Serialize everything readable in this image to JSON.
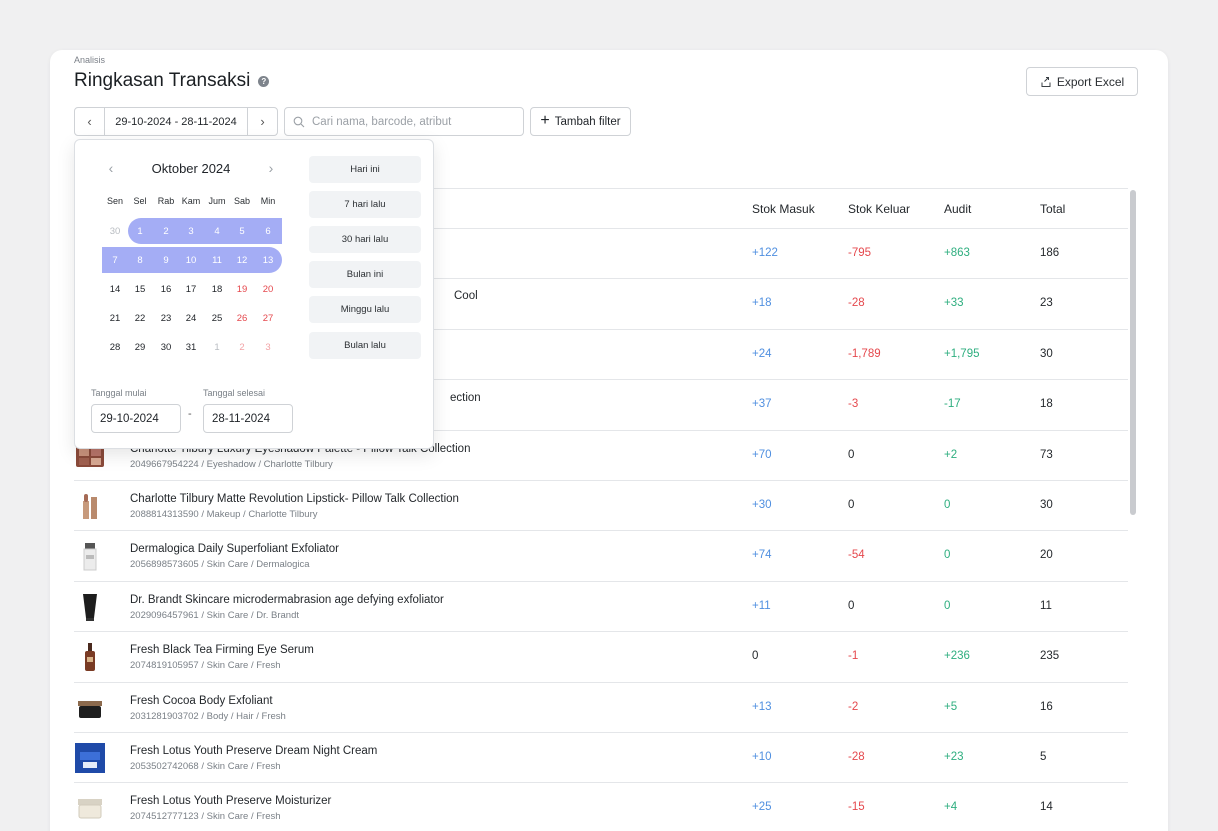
{
  "header": {
    "eyebrow": "Analisis",
    "title": "Ringkasan Transaksi",
    "help": "?",
    "export_label": "Export Excel"
  },
  "toolbar": {
    "prev": "‹",
    "next": "›",
    "date_range": "29-10-2024 - 28-11-2024",
    "search_placeholder": "Cari nama, barcode, atribut",
    "add_filter_label": "Tambah filter"
  },
  "table": {
    "columns": [
      "Stok Masuk",
      "Stok Keluar",
      "Audit",
      "Total"
    ],
    "rows": [
      {
        "name": "",
        "sub": "",
        "in": "+122",
        "out": "-795",
        "audit": "+863",
        "total": "186",
        "in_tone": "blue",
        "out_tone": "red",
        "audit_tone": "green",
        "thumb": "none"
      },
      {
        "name": "Cool",
        "sub": "",
        "in": "+18",
        "out": "-28",
        "audit": "+33",
        "total": "23",
        "in_tone": "blue",
        "out_tone": "red",
        "audit_tone": "green",
        "thumb": "none"
      },
      {
        "name": "",
        "sub": "",
        "in": "+24",
        "out": "-1,789",
        "audit": "+1,795",
        "total": "30",
        "in_tone": "blue",
        "out_tone": "red",
        "audit_tone": "green",
        "thumb": "none"
      },
      {
        "name": "ection",
        "sub": "",
        "in": "+37",
        "out": "-3",
        "audit": "-17",
        "total": "18",
        "in_tone": "blue",
        "out_tone": "red",
        "audit_tone": "green",
        "thumb": "none"
      },
      {
        "name": "Charlotte Tilbury Luxury Eyeshadow Palette - Pillow Talk Collection",
        "sub": "2049667954224 / Eyeshadow / Charlotte Tilbury",
        "in": "+70",
        "out": "0",
        "audit": "+2",
        "total": "73",
        "in_tone": "blue",
        "out_tone": "neutral",
        "audit_tone": "green",
        "thumb": "palette"
      },
      {
        "name": "Charlotte Tilbury Matte Revolution Lipstick- Pillow Talk Collection",
        "sub": "2088814313590 / Makeup / Charlotte Tilbury",
        "in": "+30",
        "out": "0",
        "audit": "0",
        "total": "30",
        "in_tone": "blue",
        "out_tone": "neutral",
        "audit_tone": "green",
        "thumb": "lipstick"
      },
      {
        "name": "Dermalogica Daily Superfoliant Exfoliator",
        "sub": "2056898573605 / Skin Care / Dermalogica",
        "in": "+74",
        "out": "-54",
        "audit": "0",
        "total": "20",
        "in_tone": "blue",
        "out_tone": "red",
        "audit_tone": "green",
        "thumb": "bottle-white"
      },
      {
        "name": "Dr. Brandt Skincare microdermabrasion age defying exfoliator",
        "sub": "2029096457961 / Skin Care / Dr. Brandt",
        "in": "+11",
        "out": "0",
        "audit": "0",
        "total": "11",
        "in_tone": "blue",
        "out_tone": "neutral",
        "audit_tone": "green",
        "thumb": "tube-black"
      },
      {
        "name": "Fresh Black Tea Firming Eye Serum",
        "sub": "2074819105957 / Skin Care / Fresh",
        "in": "0",
        "out": "-1",
        "audit": "+236",
        "total": "235",
        "in_tone": "neutral",
        "out_tone": "red",
        "audit_tone": "green",
        "thumb": "serum"
      },
      {
        "name": "Fresh Cocoa Body Exfoliant",
        "sub": "2031281903702 / Body / Hair / Fresh",
        "in": "+13",
        "out": "-2",
        "audit": "+5",
        "total": "16",
        "in_tone": "blue",
        "out_tone": "red",
        "audit_tone": "green",
        "thumb": "jar-dark"
      },
      {
        "name": "Fresh Lotus Youth Preserve Dream Night Cream",
        "sub": "2053502742068 / Skin Care / Fresh",
        "in": "+10",
        "out": "-28",
        "audit": "+23",
        "total": "5",
        "in_tone": "blue",
        "out_tone": "red",
        "audit_tone": "green",
        "thumb": "box-blue"
      },
      {
        "name": "Fresh Lotus Youth Preserve Moisturizer",
        "sub": "2074512777123 / Skin Care / Fresh",
        "in": "+25",
        "out": "-15",
        "audit": "+4",
        "total": "14",
        "in_tone": "blue",
        "out_tone": "red",
        "audit_tone": "green",
        "thumb": "jar-light"
      }
    ]
  },
  "datepicker": {
    "month_label": "Oktober 2024",
    "weekdays": [
      "Sen",
      "Sel",
      "Rab",
      "Kam",
      "Jum",
      "Sab",
      "Min"
    ],
    "weeks": [
      [
        "30",
        "1",
        "2",
        "3",
        "4",
        "5",
        "6"
      ],
      [
        "7",
        "8",
        "9",
        "10",
        "11",
        "12",
        "13"
      ],
      [
        "14",
        "15",
        "16",
        "17",
        "18",
        "19",
        "20"
      ],
      [
        "21",
        "22",
        "23",
        "24",
        "25",
        "26",
        "27"
      ],
      [
        "28",
        "29",
        "30",
        "31",
        "1",
        "2",
        "3"
      ]
    ],
    "presets": [
      "Hari ini",
      "7 hari lalu",
      "30 hari lalu",
      "Bulan ini",
      "Minggu lalu",
      "Bulan lalu"
    ],
    "start_label": "Tanggal mulai",
    "end_label": "Tanggal selesai",
    "start_value": "29-10-2024",
    "end_value": "28-11-2024",
    "separator": "-"
  },
  "colors": {
    "positive_in": "#4f8fe0",
    "negative": "#e5484d",
    "positive_audit": "#2eae7f",
    "range_highlight": "#a4adf5"
  }
}
